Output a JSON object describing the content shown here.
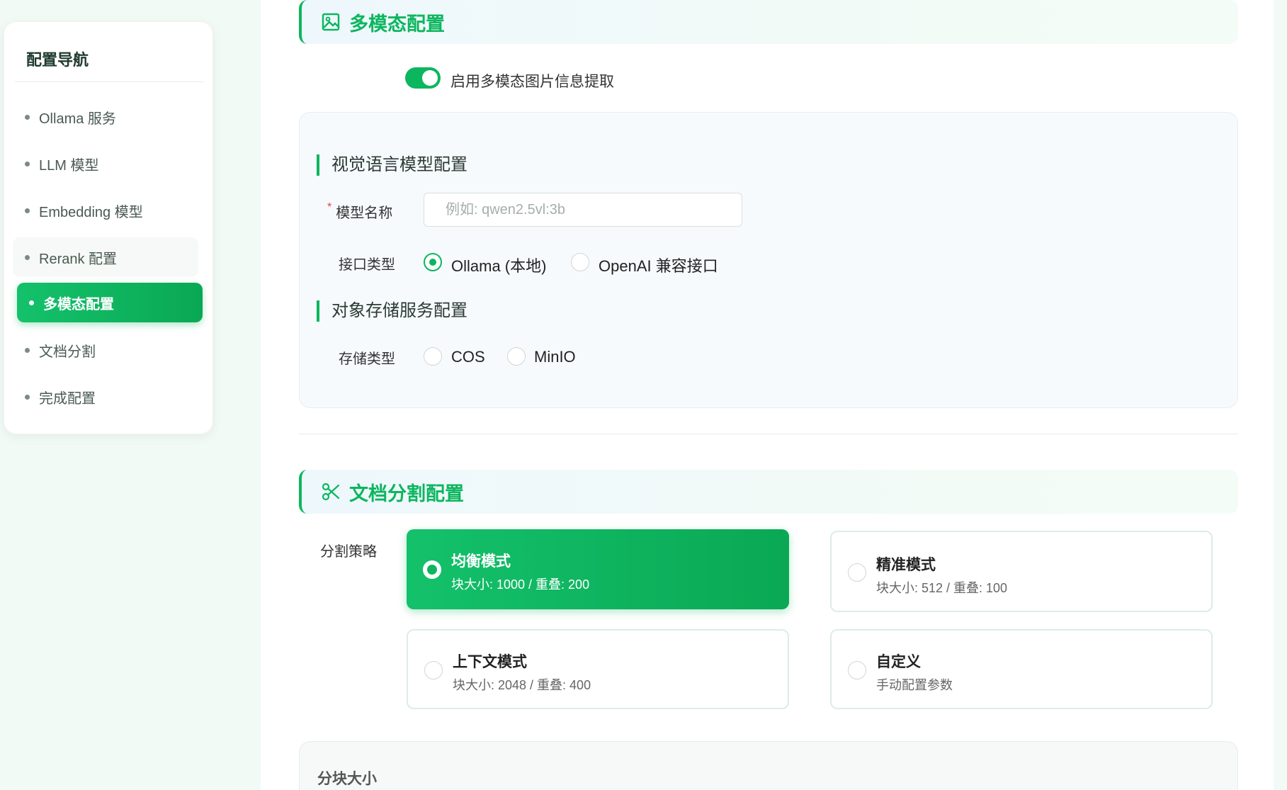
{
  "sidebar": {
    "title": "配置导航",
    "items": [
      {
        "label": "Ollama 服务"
      },
      {
        "label": "LLM 模型"
      },
      {
        "label": "Embedding 模型"
      },
      {
        "label": "Rerank 配置"
      },
      {
        "label": "多模态配置"
      },
      {
        "label": "文档分割"
      },
      {
        "label": "完成配置"
      }
    ],
    "active_index": 4
  },
  "multimodal": {
    "title": "多模态配置",
    "toggle_label": "启用多模态图片信息提取",
    "toggle_on": true,
    "vlm": {
      "subtitle": "视觉语言模型配置",
      "model_name_label": "模型名称",
      "model_name_placeholder": "例如: qwen2.5vl:3b",
      "model_name_value": "",
      "interface_label": "接口类型",
      "interface_options": [
        "Ollama (本地)",
        "OpenAI 兼容接口"
      ],
      "interface_selected": "Ollama (本地)"
    },
    "storage": {
      "subtitle": "对象存储服务配置",
      "type_label": "存储类型",
      "options": [
        "COS",
        "MinIO"
      ],
      "selected": null
    }
  },
  "splitting": {
    "title": "文档分割配置",
    "strategy_label": "分割策略",
    "strategies": [
      {
        "title": "均衡模式",
        "desc": "块大小: 1000 / 重叠: 200",
        "selected": true
      },
      {
        "title": "精准模式",
        "desc": "块大小: 512 / 重叠: 100",
        "selected": false
      },
      {
        "title": "上下文模式",
        "desc": "块大小: 2048 / 重叠: 400",
        "selected": false
      },
      {
        "title": "自定义",
        "desc": "手动配置参数",
        "selected": false
      }
    ],
    "chunk_size_label": "分块大小"
  },
  "colors": {
    "accent": "#0cb65e",
    "background": "#f2faf6"
  },
  "icons": {
    "multimodal": "image-icon",
    "splitting": "scissors-icon"
  }
}
